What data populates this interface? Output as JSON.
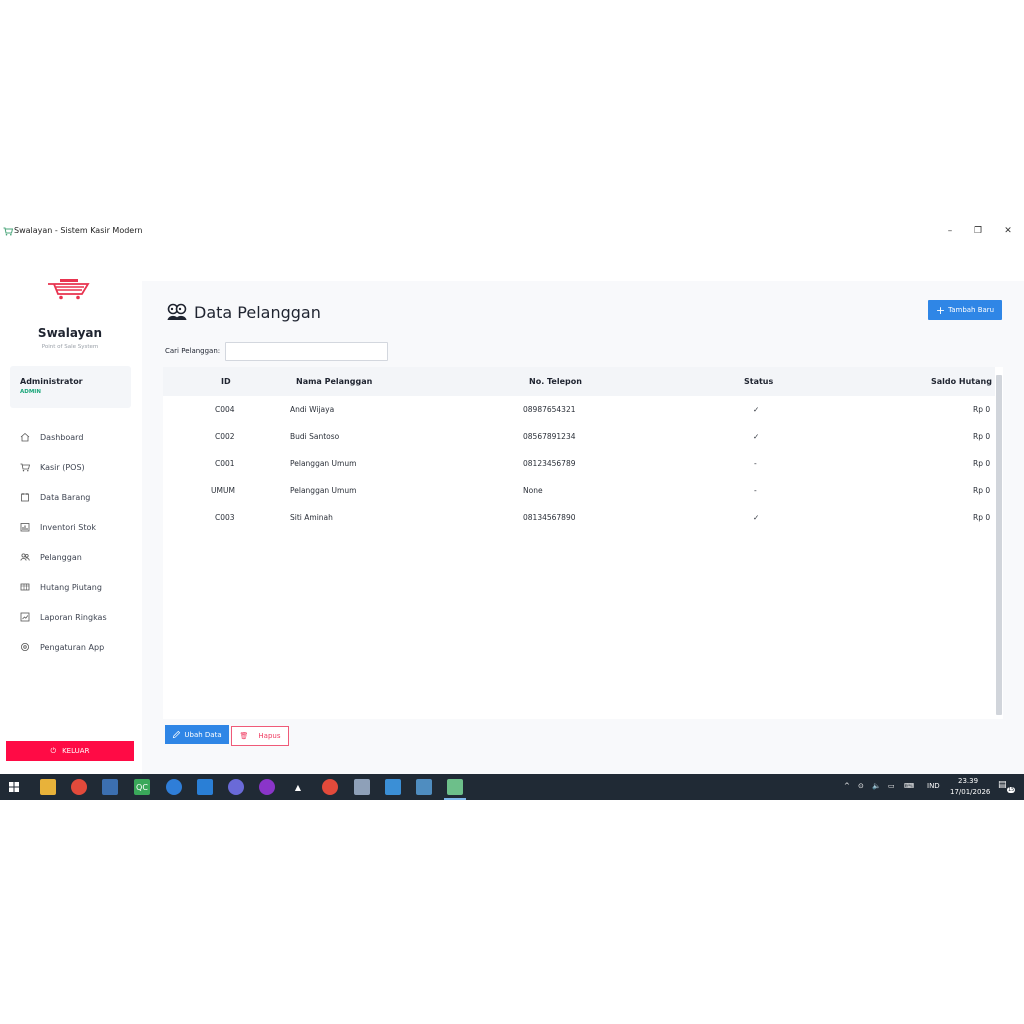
{
  "window": {
    "title": "Swalayan - Sistem Kasir Modern",
    "minimize": "–",
    "restore": "❐",
    "close": "✕"
  },
  "sidebar": {
    "brand": "Swalayan",
    "brand_sub": "Point of Sale System",
    "user_name": "Administrator",
    "user_role": "ADMIN",
    "items": [
      {
        "label": "Dashboard",
        "icon": "home-icon"
      },
      {
        "label": "Kasir (POS)",
        "icon": "cart-icon"
      },
      {
        "label": "Data Barang",
        "icon": "box-icon"
      },
      {
        "label": "Inventori Stok",
        "icon": "chart-icon"
      },
      {
        "label": "Pelanggan",
        "icon": "users-icon"
      },
      {
        "label": "Hutang Piutang",
        "icon": "ledger-icon"
      },
      {
        "label": "Laporan Ringkas",
        "icon": "report-icon"
      },
      {
        "label": "Pengaturan App",
        "icon": "gear-icon"
      }
    ],
    "logout_label": "KELUAR"
  },
  "main": {
    "title": "Data Pelanggan",
    "add_label": "Tambah Baru",
    "search_label": "Cari Pelanggan:",
    "search_value": "",
    "columns": [
      "ID",
      "Nama Pelanggan",
      "No. Telepon",
      "Status",
      "Saldo Hutang"
    ],
    "rows": [
      {
        "id": "C004",
        "name": "Andi Wijaya",
        "phone": "08987654321",
        "status": "✓",
        "debt": "Rp 0"
      },
      {
        "id": "C002",
        "name": "Budi Santoso",
        "phone": "08567891234",
        "status": "✓",
        "debt": "Rp 0"
      },
      {
        "id": "C001",
        "name": "Pelanggan Umum",
        "phone": "08123456789",
        "status": "-",
        "debt": "Rp 0"
      },
      {
        "id": "UMUM",
        "name": "Pelanggan Umum",
        "phone": "None",
        "status": "-",
        "debt": "Rp 0"
      },
      {
        "id": "C003",
        "name": "Siti Aminah",
        "phone": "08134567890",
        "status": "✓",
        "debt": "Rp 0"
      }
    ],
    "edit_label": "Ubah Data",
    "delete_label": "Hapus"
  },
  "taskbar": {
    "tray_lang": "IND",
    "time": "23.39",
    "date": "17/01/2026",
    "notification_count": "15"
  },
  "colors": {
    "primary": "#2f86e6",
    "danger": "#ff0b45",
    "role": "#1aa67a",
    "taskbar": "#202a35"
  }
}
